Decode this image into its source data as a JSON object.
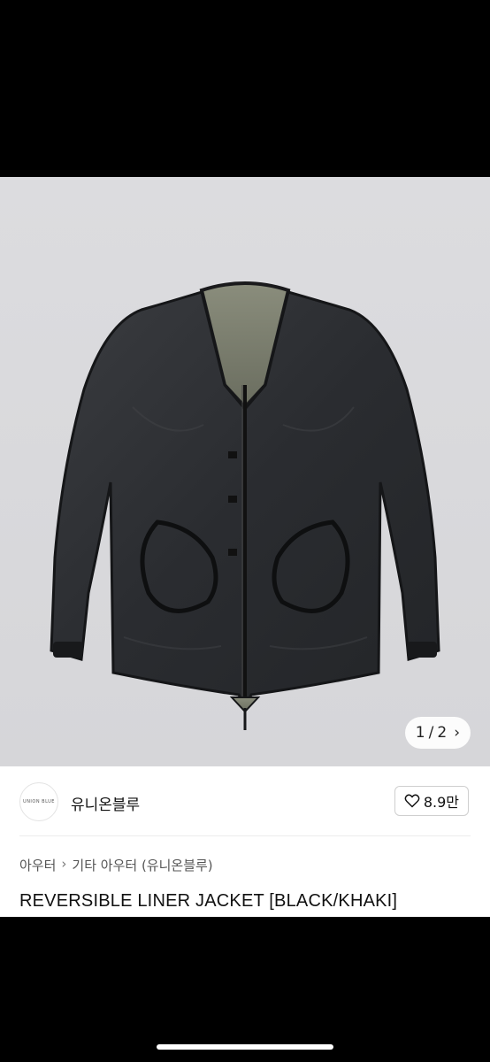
{
  "gallery": {
    "image_subject": "black reversible liner jacket",
    "current_page": "1",
    "separator": "/",
    "total_pages": "2",
    "chevron": "›"
  },
  "seller": {
    "avatar_text": "UNION BLUE",
    "name": "유니온블루",
    "likes": "8.9만"
  },
  "breadcrumb": {
    "category": "아우터",
    "separator": "›",
    "subcategory": "기타 아우터 (유니온블루)"
  },
  "product": {
    "title": "REVERSIBLE LINER JACKET [BLACK/KHAKI]"
  },
  "colors": {
    "jacket": "#2b2d30",
    "lining": "#7a7d6e",
    "background": "#d8d8db"
  }
}
